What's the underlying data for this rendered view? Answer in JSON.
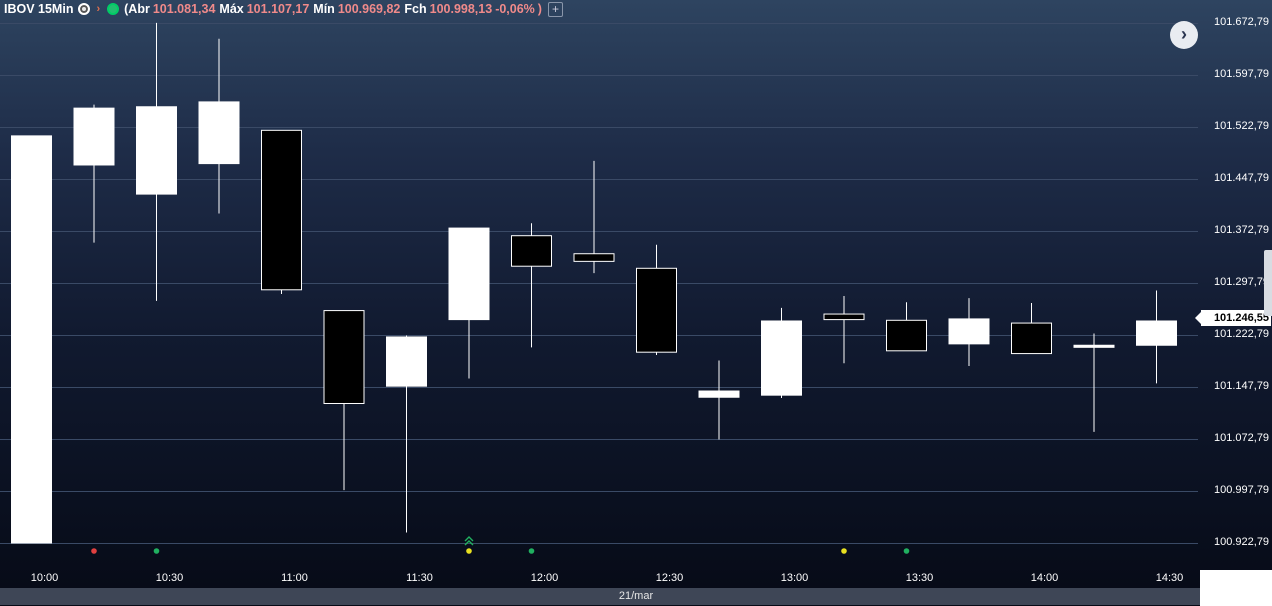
{
  "header": {
    "symbol": "IBOV 15Min",
    "open_label": "(Abr",
    "open_value": "101.081,34",
    "high_label": "Máx",
    "high_value": "101.107,17",
    "low_label": "Mín",
    "low_value": "100.969,82",
    "close_label": "Fch",
    "close_value": "100.998,13",
    "change_value": "-0,06%",
    "close_paren": ")",
    "plus": "+"
  },
  "nav_button": "›",
  "current_price": "101.246,55",
  "date_label": "21/mar",
  "y_labels": [
    "101.672,79",
    "101.597,79",
    "101.522,79",
    "101.447,79",
    "101.372,79",
    "101.297,79",
    "101.222,79",
    "101.147,79",
    "101.072,79",
    "100.997,79",
    "100.922,79"
  ],
  "x_labels": [
    "10:00",
    "10:30",
    "11:00",
    "11:30",
    "12:00",
    "12:30",
    "13:00",
    "13:30",
    "14:00",
    "14:30"
  ],
  "colors": {
    "up": "#ffffff",
    "down": "#000000",
    "wick": "#ffffff",
    "grid": "#3a4a66",
    "dot_red": "#e04040",
    "dot_green": "#20b060",
    "dot_yellow": "#e8e020"
  },
  "chart_data": {
    "type": "candlestick",
    "title": "IBOV 15Min",
    "ylim": [
      100922.79,
      101672.79
    ],
    "y_ticks": [
      100922.79,
      100997.79,
      101072.79,
      101147.79,
      101222.79,
      101297.79,
      101372.79,
      101447.79,
      101522.79,
      101597.79,
      101672.79
    ],
    "x": [
      "10:00",
      "10:15",
      "10:30",
      "10:45",
      "11:00",
      "11:15",
      "11:30",
      "11:45",
      "12:00",
      "12:15",
      "12:30",
      "12:45",
      "13:00",
      "13:15",
      "13:30",
      "13:45",
      "14:00",
      "14:15",
      "14:30"
    ],
    "candles": [
      {
        "t": "10:00",
        "o": 100922.8,
        "h": 101510,
        "l": 100922.8,
        "c": 101510
      },
      {
        "t": "10:15",
        "o": 101468,
        "h": 101555,
        "l": 101356,
        "c": 101550
      },
      {
        "t": "10:30",
        "o": 101426,
        "h": 101673,
        "l": 101272,
        "c": 101552
      },
      {
        "t": "10:45",
        "o": 101470,
        "h": 101650,
        "l": 101398,
        "c": 101559
      },
      {
        "t": "11:00",
        "o": 101518,
        "h": 101518,
        "l": 101282,
        "c": 101288
      },
      {
        "t": "11:15",
        "o": 101258,
        "h": 101258,
        "l": 100999,
        "c": 101124
      },
      {
        "t": "11:30",
        "o": 101149,
        "h": 101222,
        "l": 100938,
        "c": 101220
      },
      {
        "t": "11:45",
        "o": 101245,
        "h": 101377,
        "l": 101160,
        "c": 101377
      },
      {
        "t": "12:00",
        "o": 101366,
        "h": 101384,
        "l": 101205,
        "c": 101322
      },
      {
        "t": "12:15",
        "o": 101340,
        "h": 101474,
        "l": 101312,
        "c": 101329
      },
      {
        "t": "12:30",
        "o": 101319,
        "h": 101353,
        "l": 101194,
        "c": 101198
      },
      {
        "t": "12:45",
        "o": 101133,
        "h": 101186,
        "l": 101072,
        "c": 101142
      },
      {
        "t": "13:00",
        "o": 101136,
        "h": 101262,
        "l": 101132,
        "c": 101243
      },
      {
        "t": "13:15",
        "o": 101253,
        "h": 101279,
        "l": 101182,
        "c": 101245
      },
      {
        "t": "13:30",
        "o": 101244,
        "h": 101270,
        "l": 101200,
        "c": 101200
      },
      {
        "t": "13:45",
        "o": 101210,
        "h": 101276,
        "l": 101178,
        "c": 101246
      },
      {
        "t": "14:00",
        "o": 101240,
        "h": 101269,
        "l": 101196,
        "c": 101196
      },
      {
        "t": "14:15",
        "o": 101205,
        "h": 101225,
        "l": 101083,
        "c": 101208
      },
      {
        "t": "14:30",
        "o": 101208,
        "h": 101287,
        "l": 101153,
        "c": 101243
      }
    ],
    "markers": [
      {
        "t": "10:15",
        "color": "red"
      },
      {
        "t": "10:30",
        "color": "green"
      },
      {
        "t": "11:45",
        "color": "yellow"
      },
      {
        "t": "12:00",
        "color": "green"
      },
      {
        "t": "13:15",
        "color": "yellow"
      },
      {
        "t": "13:30",
        "color": "green"
      }
    ],
    "annotations": [
      {
        "t": "11:45",
        "symbol": "double-chevron-up"
      }
    ],
    "current_price": 101246.55,
    "grid": true
  }
}
